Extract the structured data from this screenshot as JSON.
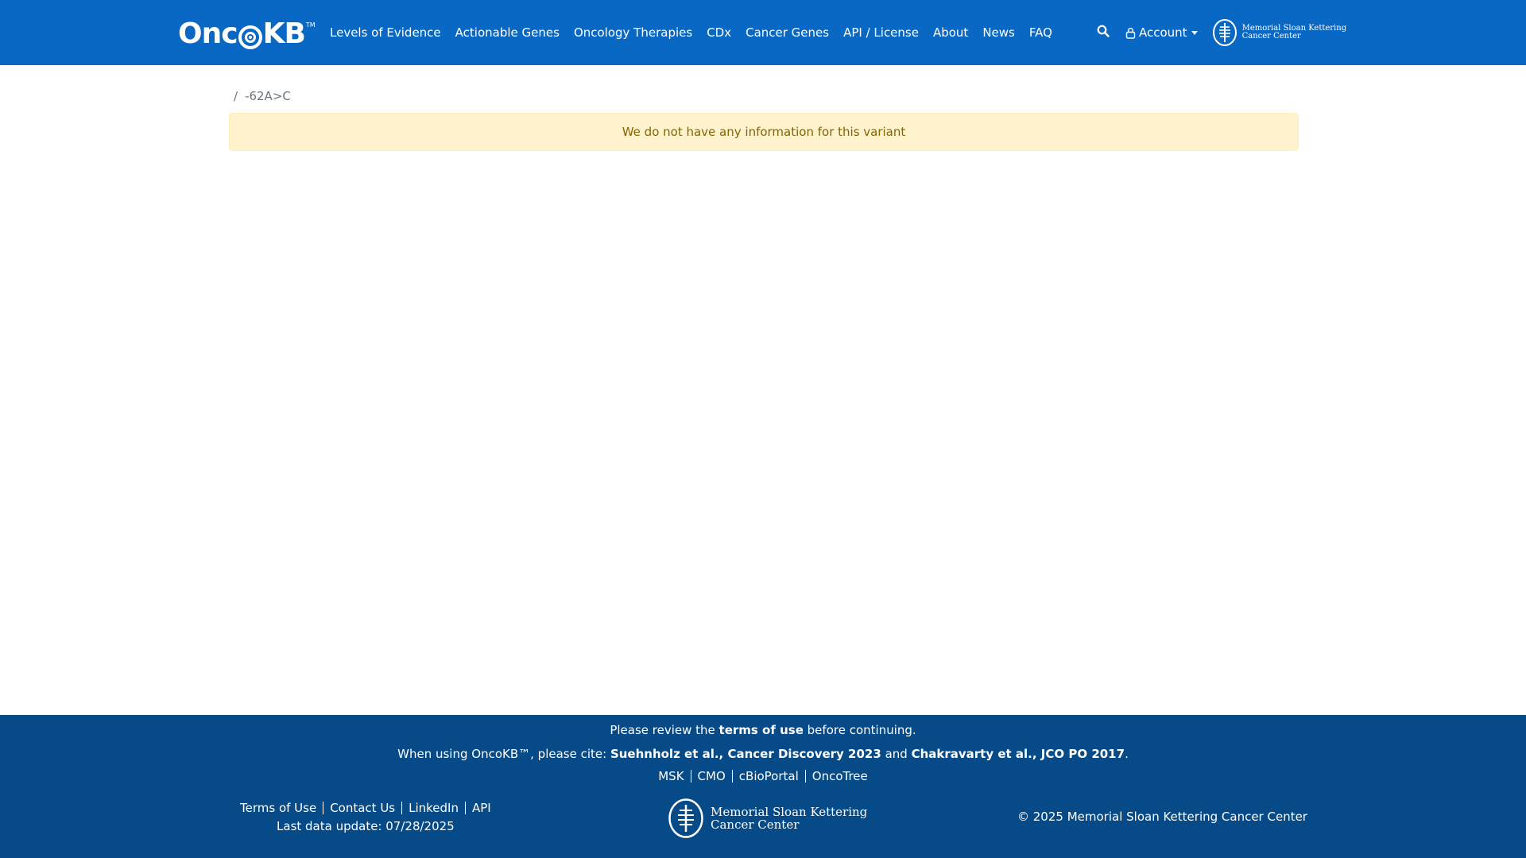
{
  "brand": {
    "name": "OncoKB",
    "name_left": "Onc",
    "name_right": "KB",
    "trademark": "TM"
  },
  "nav": {
    "links": [
      {
        "label": "Levels of Evidence"
      },
      {
        "label": "Actionable Genes"
      },
      {
        "label": "Oncology Therapies"
      },
      {
        "label": "CDx"
      },
      {
        "label": "Cancer Genes"
      },
      {
        "label": "API / License"
      },
      {
        "label": "About"
      },
      {
        "label": "News"
      },
      {
        "label": "FAQ"
      }
    ],
    "account_label": "Account",
    "msk_logo_line1": "Memorial Sloan Kettering",
    "msk_logo_line2": "Cancer Center"
  },
  "breadcrumb": {
    "separator": "/",
    "variant": "-62A>C"
  },
  "alert": {
    "message": "We do not have any information for this variant"
  },
  "footer": {
    "review_prefix": "Please review the ",
    "review_link": "terms of use",
    "review_suffix": " before continuing.",
    "cite_prefix": "When using OncoKB™, please cite: ",
    "cite_1": "Suehnholz et al., Cancer Discovery 2023",
    "cite_and": " and ",
    "cite_2": "Chakravarty et al., JCO PO 2017",
    "cite_end": ".",
    "resources": [
      "MSK",
      "CMO",
      "cBioPortal",
      "OncoTree"
    ],
    "links": [
      "Terms of Use",
      "Contact Us",
      "LinkedIn",
      "API"
    ],
    "last_update": "Last data update: 07/28/2025",
    "logo_line1": "Memorial Sloan Kettering",
    "logo_line2": "Cancer Center",
    "copyright": "© 2025 Memorial Sloan Kettering Cancer Center"
  },
  "colors": {
    "navbar": "#0968c3",
    "footer": "#064a87",
    "alert_bg": "#fff3cd",
    "alert_text": "#856404"
  },
  "icons": [
    "search-icon",
    "user-icon",
    "caret-down-icon",
    "msk-logo-icon"
  ]
}
